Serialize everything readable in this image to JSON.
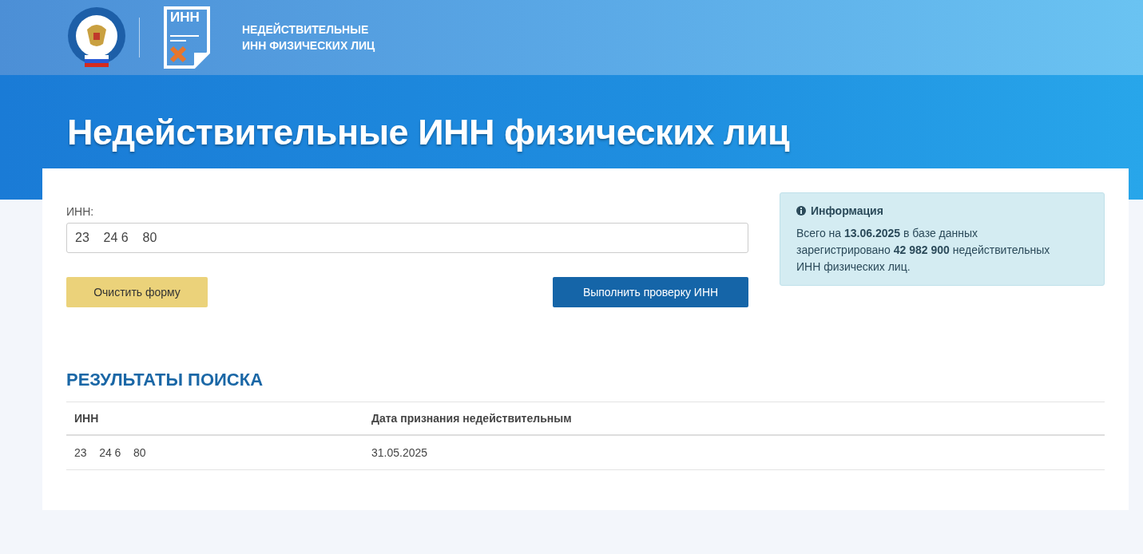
{
  "header": {
    "logo_badge": "ИНН",
    "title_lines": [
      "НЕДЕЙСТВИТЕЛЬНЫЕ",
      "ИНН ФИЗИЧЕСКИХ ЛИЦ"
    ]
  },
  "page_title": "Недействительные ИНН физических лиц",
  "form": {
    "label": "ИНН:",
    "value": "23    24 6    80",
    "buttons": [
      {
        "label": "Очистить форму",
        "kind": "secondary"
      },
      {
        "label": "Выполнить проверку ИНН",
        "kind": "primary"
      }
    ]
  },
  "info": {
    "title": "Информация",
    "text": "Всего на **13.06.2025** в базе данных зарегистрировано **42 982 900** недействительных ИНН физических лиц."
  },
  "results": {
    "title": "РЕЗУЛЬТАТЫ ПОИСКА",
    "columns": [
      "ИНН",
      "Дата признания недействительным"
    ],
    "rows": [
      [
        "23    24 6    80",
        "31.05.2025"
      ]
    ]
  }
}
